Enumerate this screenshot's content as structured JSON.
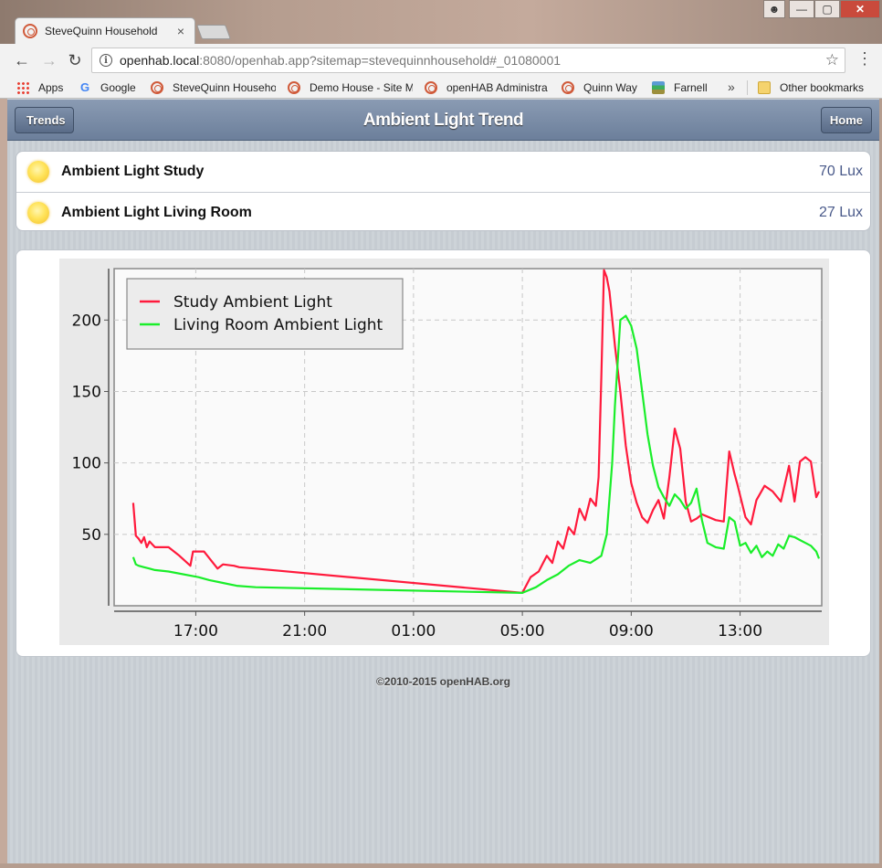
{
  "browser": {
    "tab_title": "SteveQuinn Household",
    "tab_close": "×",
    "url_host": "openhab.local",
    "url_rest": ":8080/openhab.app?sitemap=stevequinnhousehold#_01080001",
    "bookmarks": [
      {
        "label": "Apps",
        "icon": "apps-icon"
      },
      {
        "label": "Google",
        "icon": "google-icon"
      },
      {
        "label": "SteveQuinn Househo",
        "icon": "openhab-icon"
      },
      {
        "label": "Demo House - Site M",
        "icon": "openhab-icon"
      },
      {
        "label": "openHAB Administra",
        "icon": "openhab-icon"
      },
      {
        "label": "Quinn Way",
        "icon": "openhab-icon"
      },
      {
        "label": "Farnell",
        "icon": "farnell-icon"
      }
    ],
    "more_bookmarks": "»",
    "other_bookmarks": "Other bookmarks"
  },
  "header": {
    "back_label": "Trends",
    "title": "Ambient Light Trend",
    "home_label": "Home"
  },
  "items": [
    {
      "label": "Ambient Light Study",
      "value": "70 Lux",
      "icon": "sun-icon"
    },
    {
      "label": "Ambient Light Living Room",
      "value": "27 Lux",
      "icon": "sun-icon"
    }
  ],
  "footer": "©2010-2015 openHAB.org",
  "colors": {
    "study": "#ff1a3c",
    "living": "#1aee2a",
    "header": "#6c7f9b"
  },
  "chart_data": {
    "type": "line",
    "title": "",
    "xlabel": "",
    "ylabel": "",
    "x_unit": "hours since 14:00 on day 1 (x axis ticks: 17:00 to 13:00 next day)",
    "xlim": [
      0,
      26
    ],
    "ylim": [
      0,
      236
    ],
    "x_ticks": [
      3,
      7,
      11,
      15,
      19,
      23
    ],
    "x_tick_labels": [
      "17:00",
      "21:00",
      "01:00",
      "05:00",
      "09:00",
      "13:00"
    ],
    "y_ticks": [
      50,
      100,
      150,
      200
    ],
    "y_tick_labels": [
      "50",
      "100",
      "150",
      "200"
    ],
    "grid": true,
    "legend_position": "top-left",
    "series": [
      {
        "name": "Study Ambient Light",
        "color": "#ff1a3c",
        "x": [
          0.7,
          0.8,
          0.9,
          1.0,
          1.1,
          1.2,
          1.3,
          1.5,
          2.0,
          2.4,
          2.8,
          2.9,
          3.3,
          3.8,
          4.0,
          4.4,
          4.6,
          5.2,
          15.0,
          15.3,
          15.6,
          15.9,
          16.1,
          16.3,
          16.5,
          16.7,
          16.9,
          17.1,
          17.3,
          17.5,
          17.7,
          17.8,
          17.9,
          18.0,
          18.1,
          18.2,
          18.4,
          18.6,
          18.8,
          19.0,
          19.2,
          19.4,
          19.6,
          19.8,
          20.0,
          20.2,
          20.4,
          20.6,
          20.8,
          21.0,
          21.2,
          21.4,
          21.6,
          22.1,
          22.4,
          22.6,
          22.8,
          22.9,
          23.2,
          23.4,
          23.6,
          23.9,
          24.2,
          24.5,
          24.8,
          25.0,
          25.2,
          25.4,
          25.6,
          25.8,
          25.9
        ],
        "values": [
          72,
          49,
          47,
          44,
          48,
          41,
          45,
          41,
          41,
          35,
          28,
          38,
          38,
          26,
          29,
          28,
          27,
          26,
          9,
          20,
          24,
          35,
          30,
          45,
          40,
          55,
          50,
          68,
          60,
          75,
          70,
          90,
          160,
          235,
          230,
          220,
          182,
          150,
          112,
          86,
          72,
          62,
          58,
          67,
          74,
          61,
          90,
          124,
          110,
          73,
          59,
          61,
          64,
          60,
          59,
          108,
          92,
          85,
          62,
          57,
          74,
          84,
          80,
          73,
          98,
          73,
          101,
          104,
          101,
          76,
          80
        ]
      },
      {
        "name": "Living Room Ambient Light",
        "color": "#1aee2a",
        "x": [
          0.7,
          0.8,
          0.9,
          1.1,
          1.3,
          1.5,
          2.0,
          3.1,
          3.5,
          4.0,
          4.5,
          5.2,
          15.0,
          15.5,
          15.9,
          16.3,
          16.7,
          17.1,
          17.5,
          17.9,
          18.1,
          18.3,
          18.4,
          18.6,
          18.8,
          19.0,
          19.2,
          19.4,
          19.6,
          19.8,
          20.0,
          20.2,
          20.4,
          20.6,
          20.8,
          21.0,
          21.2,
          21.4,
          21.6,
          21.8,
          22.1,
          22.4,
          22.6,
          22.8,
          23.0,
          23.2,
          23.4,
          23.6,
          23.8,
          24.0,
          24.2,
          24.4,
          24.6,
          24.8,
          25.0,
          25.2,
          25.4,
          25.6,
          25.8,
          25.9
        ],
        "values": [
          34,
          29,
          28,
          27,
          26,
          25,
          24,
          20,
          18,
          16,
          14,
          13,
          9,
          13,
          18,
          22,
          28,
          32,
          30,
          35,
          50,
          100,
          140,
          200,
          203,
          196,
          180,
          150,
          120,
          98,
          83,
          76,
          70,
          78,
          74,
          68,
          72,
          82,
          60,
          44,
          41,
          40,
          62,
          59,
          42,
          44,
          37,
          42,
          34,
          38,
          35,
          43,
          40,
          49,
          48,
          46,
          44,
          42,
          38,
          33
        ]
      }
    ]
  }
}
